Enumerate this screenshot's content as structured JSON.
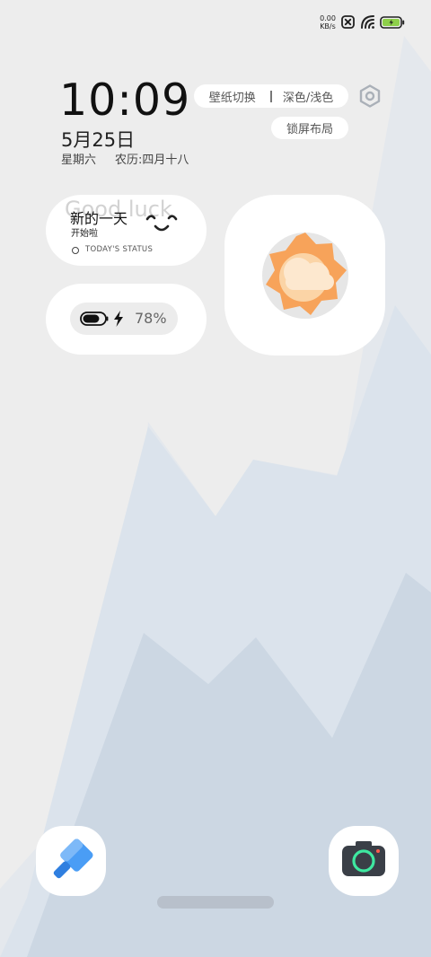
{
  "status_bar": {
    "net_speed_value": "0.00",
    "net_speed_unit": "KB/s",
    "icons": [
      "sim-no-signal-icon",
      "wifi-icon",
      "battery-charging-icon"
    ]
  },
  "clock": {
    "time": "10:09",
    "date": "5月25日",
    "weekday": "星期六",
    "lunar": "农历:四月十八"
  },
  "controls": {
    "wallpaper_switch": "壁纸切换",
    "theme_toggle": "深色/浅色",
    "lock_layout": "锁屏布局",
    "settings_icon": "settings-hexagon-icon"
  },
  "greeting_widget": {
    "watermark": "Good luck",
    "title": "新的一天",
    "subtitle": "开始啦",
    "status": "TODAY'S STATUS",
    "icon": "smile-face-icon"
  },
  "battery_widget": {
    "percent_text": "78%",
    "level": 0.78,
    "icons": [
      "battery-icon",
      "lightning-icon"
    ]
  },
  "weather_widget": {
    "icon": "partly-cloudy-icon",
    "colors": {
      "sun": "#f7a35a",
      "cloud": "#fde8cf"
    }
  },
  "dock": {
    "apps": [
      {
        "name": "theme-brush-app",
        "icon": "paint-brush-icon",
        "color": "#4a9df5"
      },
      {
        "name": "camera-app",
        "icon": "camera-icon",
        "color": "#3a3f47"
      }
    ]
  },
  "colors": {
    "background": "#ededed",
    "mountain_light": "#dde4ec",
    "mountain_dark": "#cbd6e2",
    "battery_green": "#8ed04a"
  }
}
